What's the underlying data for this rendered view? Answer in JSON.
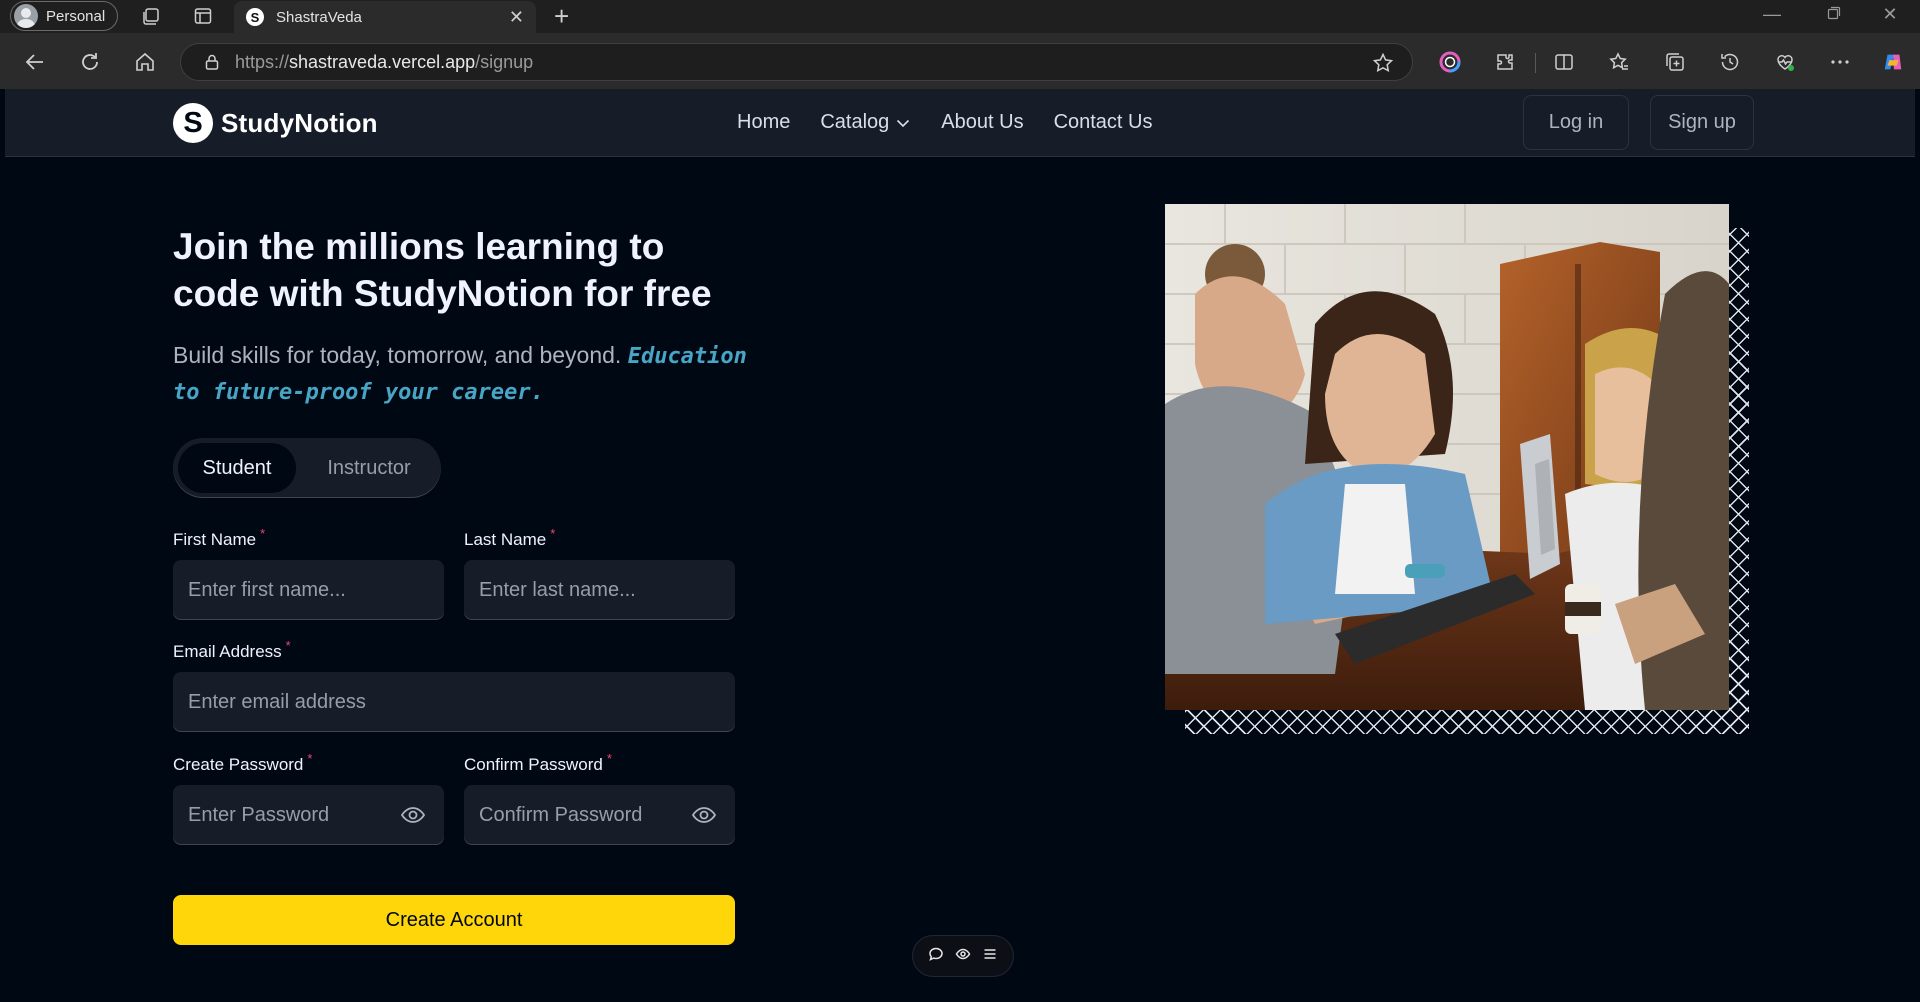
{
  "browser": {
    "profile_label": "Personal",
    "tab_title": "ShastraVeda",
    "tab_favicon_letter": "S",
    "url_scheme": "https://",
    "url_host": "shastraveda.vercel.app",
    "url_path": "/signup",
    "toolbar_icons": [
      "back-icon",
      "reload-icon",
      "home-icon",
      "lock-icon",
      "star-icon",
      "color-wheel-icon",
      "extensions-icon",
      "split-screen-icon",
      "favorites-icon",
      "collections-icon",
      "history-icon",
      "heart-pulse-icon",
      "more-icon",
      "copilot-icon"
    ],
    "window_controls": [
      "minimize",
      "restore",
      "close"
    ]
  },
  "navbar": {
    "logo_letter": "S",
    "logo_text": "StudyNotion",
    "links": [
      {
        "label": "Home"
      },
      {
        "label": "Catalog"
      },
      {
        "label": "About Us"
      },
      {
        "label": "Contact Us"
      }
    ],
    "login_label": "Log in",
    "signup_label": "Sign up"
  },
  "hero": {
    "heading": "Join the millions learning to code with StudyNotion for free",
    "subtext": "Build skills for today, tomorrow, and beyond.",
    "highlight": "Education to future-proof your career."
  },
  "form": {
    "roles": [
      "Student",
      "Instructor"
    ],
    "active_role": "Student",
    "required_marker": "*",
    "first_name": {
      "label": "First Name",
      "placeholder": "Enter first name...",
      "value": ""
    },
    "last_name": {
      "label": "Last Name",
      "placeholder": "Enter last name...",
      "value": ""
    },
    "email": {
      "label": "Email Address",
      "placeholder": "Enter email address",
      "value": ""
    },
    "password": {
      "label": "Create Password",
      "placeholder": "Enter Password",
      "value": ""
    },
    "confirm_password": {
      "label": "Confirm Password",
      "placeholder": "Confirm Password",
      "value": ""
    },
    "submit_label": "Create Account"
  },
  "colors": {
    "background": "#000814",
    "navbar": "#161D29",
    "accent_yellow": "#FFD60A",
    "highlight_blue": "#47A5C5",
    "required_pink": "#EF476F"
  },
  "floating_toolbar": {
    "icons": [
      "comment-icon",
      "eye-icon",
      "menu-icon"
    ]
  }
}
